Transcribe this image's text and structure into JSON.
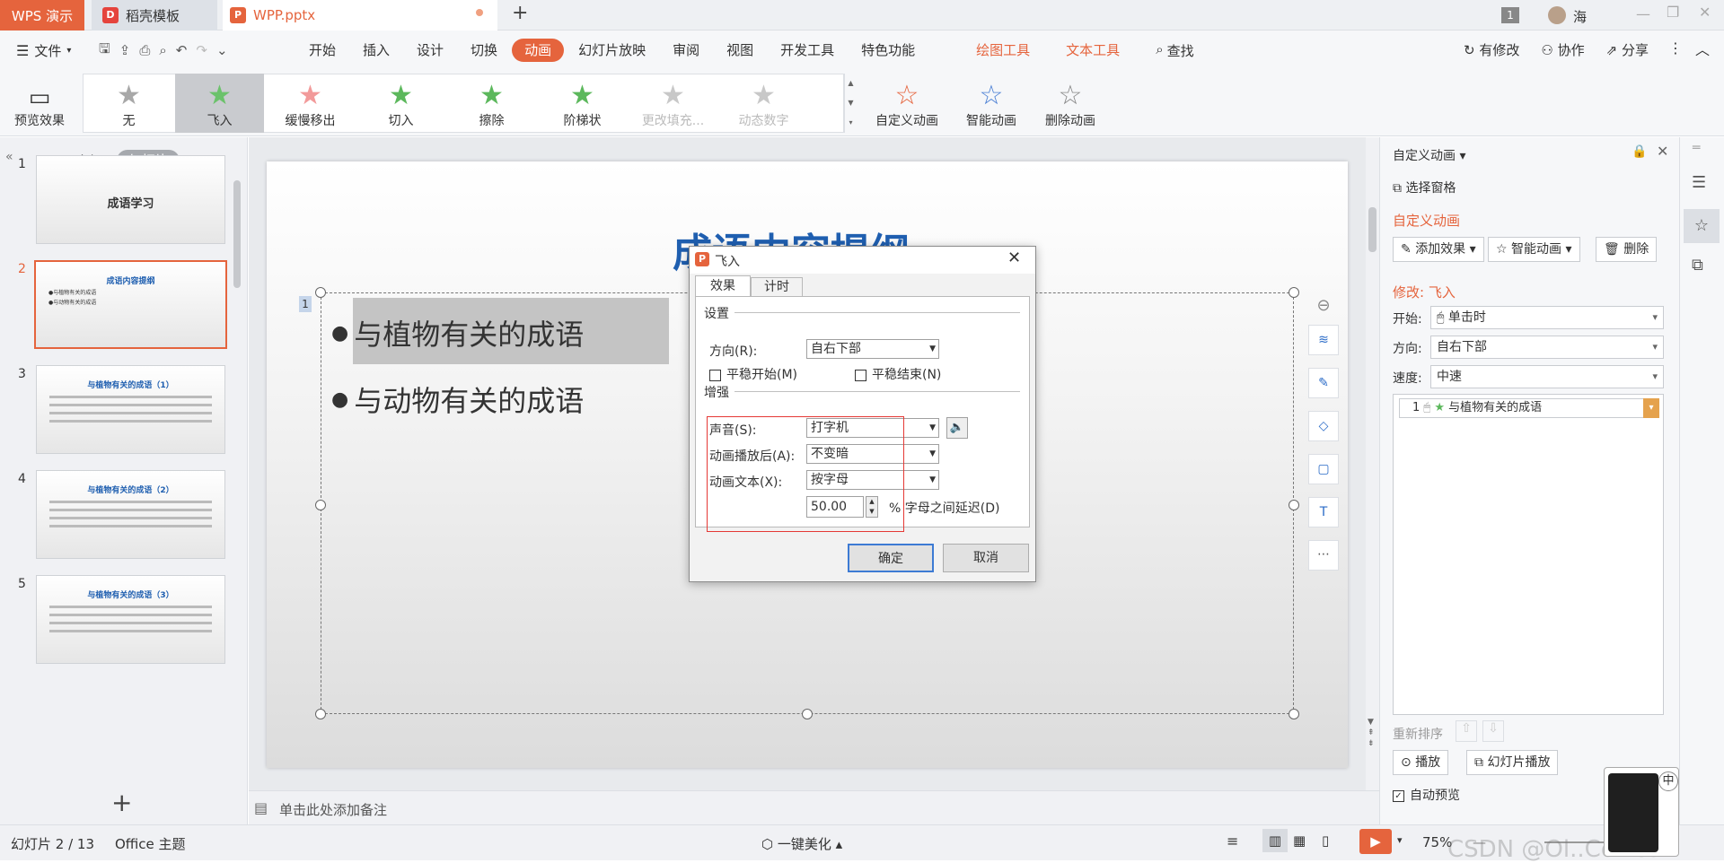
{
  "titlebar": {
    "tab_wps": "WPS 演示",
    "tab_daoke": "稻壳模板",
    "tab_file": "WPP.pptx",
    "new_tab": "+",
    "badge": "1",
    "user": "海"
  },
  "menubar": {
    "file": "文件",
    "items": [
      "开始",
      "插入",
      "设计",
      "切换",
      "动画",
      "幻灯片放映",
      "审阅",
      "视图",
      "开发工具",
      "特色功能"
    ],
    "active_index": 4,
    "orange_items": [
      "绘图工具",
      "文本工具"
    ],
    "search": "查找",
    "right": [
      "有修改",
      "协作",
      "分享"
    ]
  },
  "ribbon": {
    "preview": "预览效果",
    "effects": [
      "无",
      "飞入",
      "缓慢移出",
      "切入",
      "擦除",
      "阶梯状",
      "更改填充...",
      "动态数字"
    ],
    "custom_anim": "自定义动画",
    "smart_anim": "智能动画",
    "delete_anim": "删除动画",
    "effect_colors": [
      "#a8a8a8",
      "#6bc26b",
      "#f29a9a",
      "#5cb85c",
      "#5cb85c",
      "#5cb85c",
      "#c8c8c8",
      "#c8c8c8"
    ]
  },
  "left_panel": {
    "tab_outline": "大纲",
    "tab_slides": "幻灯片",
    "add": "+",
    "slides": [
      {
        "num": "1",
        "title": "成语学习",
        "lines": []
      },
      {
        "num": "2",
        "title": "成语内容提纲",
        "lines": [
          "●与植物有关的成语",
          "●与动物有关的成语"
        ]
      },
      {
        "num": "3",
        "title": "与植物有关的成语（1）",
        "lines": []
      },
      {
        "num": "4",
        "title": "与植物有关的成语（2）",
        "lines": []
      },
      {
        "num": "5",
        "title": "与植物有关的成语（3）",
        "lines": []
      }
    ]
  },
  "slide": {
    "title": "成语内容提纲",
    "bullet1": "与植物有关的成语",
    "bullet2": "与动物有关的成语",
    "anim_tag": "1"
  },
  "notes": "单击此处添加备注",
  "dialog": {
    "title": "飞入",
    "tab_effect": "效果",
    "tab_timing": "计时",
    "settings": "设置",
    "direction_label": "方向(R):",
    "direction_value": "自右下部",
    "smooth_start": "平稳开始(M)",
    "smooth_end": "平稳结束(N)",
    "enhance": "增强",
    "sound_label": "声音(S):",
    "sound_value": "打字机",
    "after_label": "动画播放后(A):",
    "after_value": "不变暗",
    "text_label": "动画文本(X):",
    "text_value": "按字母",
    "delay_value": "50.00",
    "delay_label": "% 字母之间延迟(D)",
    "ok": "确定",
    "cancel": "取消"
  },
  "right_panel": {
    "header": "自定义动画",
    "select_pane": "选择窗格",
    "section_title": "自定义动画",
    "add_effect": "添加效果",
    "smart_anim": "智能动画",
    "delete": "删除",
    "modify": "修改: 飞入",
    "start_label": "开始:",
    "start_value": "单击时",
    "direction_label": "方向:",
    "direction_value": "自右下部",
    "speed_label": "速度:",
    "speed_value": "中速",
    "list_item_num": "1",
    "list_item_text": "与植物有关的成语",
    "reorder": "重新排序",
    "play": "播放",
    "slideshow": "幻灯片播放",
    "auto_preview": "自动预览"
  },
  "status": {
    "slide_count": "幻灯片 2 / 13",
    "theme": "Office 主题",
    "beautify": "一键美化",
    "zoom": "75%",
    "watermark": "CSDN @Ol..Corres",
    "ime": "中"
  },
  "colors": {
    "accent": "#e5643d",
    "title_blue": "#1f5fb0",
    "highlight_red": "#e53935"
  }
}
